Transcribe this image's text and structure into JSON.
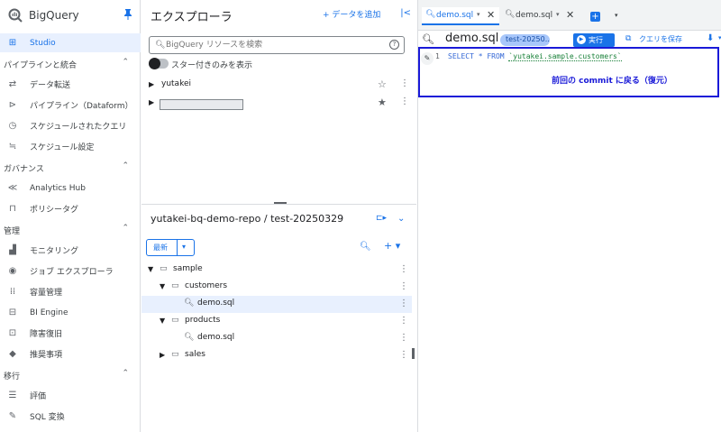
{
  "sidebar": {
    "brand": "BigQuery",
    "items": [
      {
        "label": "Studio",
        "active": true,
        "icon": "studio-icon"
      },
      {
        "label": "パイプラインと統合",
        "section": true
      },
      {
        "label": "データ転送",
        "icon": "transfer-icon"
      },
      {
        "label": "パイプライン（Dataform）",
        "icon": "pipeline-icon"
      },
      {
        "label": "スケジュールされたクエリ",
        "icon": "clock-icon"
      },
      {
        "label": "スケジュール設定",
        "icon": "schedule-icon"
      },
      {
        "label": "ガバナンス",
        "section": true
      },
      {
        "label": "Analytics Hub",
        "icon": "hub-icon"
      },
      {
        "label": "ポリシータグ",
        "icon": "lock-icon"
      },
      {
        "label": "管理",
        "section": true
      },
      {
        "label": "モニタリング",
        "icon": "chart-icon"
      },
      {
        "label": "ジョブ エクスプローラ",
        "icon": "explore-icon"
      },
      {
        "label": "容量管理",
        "icon": "capacity-icon"
      },
      {
        "label": "BI Engine",
        "icon": "engine-icon"
      },
      {
        "label": "障害復旧",
        "icon": "recovery-icon"
      },
      {
        "label": "推奨事項",
        "icon": "recommend-icon"
      },
      {
        "label": "移行",
        "section": true
      },
      {
        "label": "評価",
        "icon": "assess-icon"
      },
      {
        "label": "SQL 変換",
        "icon": "wrench-icon"
      }
    ]
  },
  "explorer": {
    "title": "エクスプローラ",
    "add_data": "+ データを追加",
    "search_placeholder": "BigQuery リソースを検索",
    "starred_toggle": "スター付きのみを表示",
    "resources": [
      {
        "label": "yutakei",
        "starred": false
      },
      {
        "label": "",
        "starred": true,
        "redacted": true
      }
    ],
    "repo_title": "yutakei-bq-demo-repo / test-20250329",
    "latest_button": "最新",
    "tree": [
      {
        "label": "sample",
        "type": "folder",
        "depth": 0,
        "expanded": true
      },
      {
        "label": "customers",
        "type": "folder",
        "depth": 1,
        "expanded": true
      },
      {
        "label": "demo.sql",
        "type": "file",
        "depth": 2,
        "selected": true
      },
      {
        "label": "products",
        "type": "folder",
        "depth": 1,
        "expanded": true
      },
      {
        "label": "demo.sql",
        "type": "file",
        "depth": 2
      },
      {
        "label": "sales",
        "type": "folder",
        "depth": 1,
        "expanded": false
      }
    ]
  },
  "editor": {
    "tabs": [
      {
        "label": "demo.sql",
        "active": true
      },
      {
        "label": "demo.sql",
        "active": false
      }
    ],
    "title": "demo.sql",
    "badge": "test-20250...",
    "run_label": "実行",
    "save_label": "クエリを保存",
    "line_number": "1",
    "code": {
      "kw": "SELECT * FROM ",
      "table": "`yutakei.sample.customers`"
    },
    "annotation": "前回の commit に戻る（復元）"
  },
  "colors": {
    "accent": "#1a73e8",
    "annotation": "#1a1ad8",
    "active_bg": "#e8f0fe"
  }
}
